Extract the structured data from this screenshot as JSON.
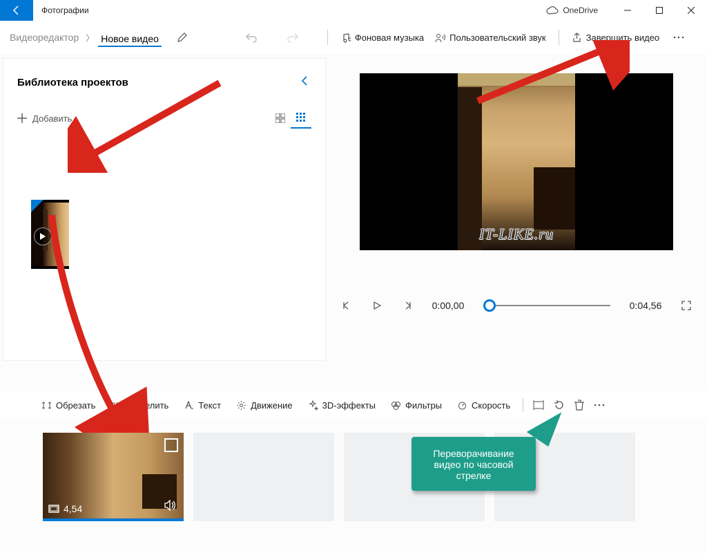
{
  "titlebar": {
    "app": "Фотографии",
    "onedrive": "OneDrive"
  },
  "toolbar": {
    "breadcrumb_root": "Видеоредактор",
    "breadcrumb_current": "Новое видео",
    "bg_music": "Фоновая музыка",
    "custom_audio": "Пользовательский звук",
    "finish": "Завершить видео"
  },
  "library": {
    "title": "Библиотека проектов",
    "add": "Добавить"
  },
  "player": {
    "time_current": "0:00,00",
    "time_total": "0:04,56",
    "watermark": "IT-LIKE.ru"
  },
  "editbar": {
    "trim": "Обрезать",
    "split": "Разделить",
    "text": "Текст",
    "motion": "Движение",
    "fx3d": "3D-эффекты",
    "filters": "Фильтры",
    "speed": "Скорость"
  },
  "clip": {
    "duration": "4,54"
  },
  "callout": {
    "text": "Переворачивание видео по часовой стрелке"
  }
}
